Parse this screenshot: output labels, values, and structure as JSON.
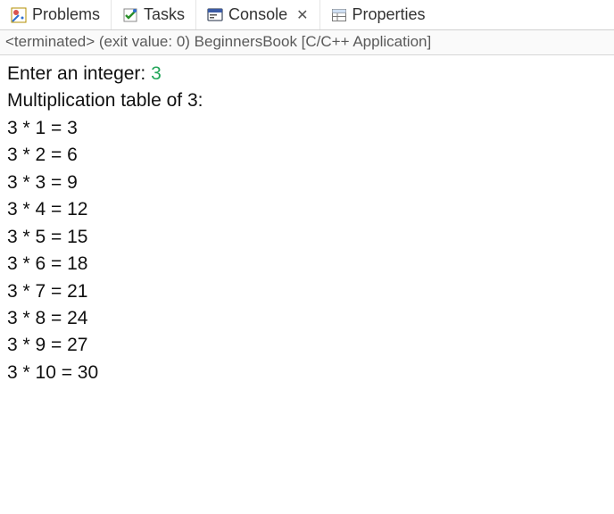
{
  "tabs": {
    "problems": "Problems",
    "tasks": "Tasks",
    "console": "Console",
    "properties": "Properties"
  },
  "status": "<terminated> (exit value: 0) BeginnersBook [C/C++ Application]",
  "console": {
    "prompt": "Enter an integer: ",
    "input": "3",
    "heading": "Multiplication table of 3:",
    "rows": [
      "3 * 1 = 3",
      "3 * 2 = 6",
      "3 * 3 = 9",
      "3 * 4 = 12",
      "3 * 5 = 15",
      "3 * 6 = 18",
      "3 * 7 = 21",
      "3 * 8 = 24",
      "3 * 9 = 27",
      "3 * 10 = 30"
    ]
  }
}
